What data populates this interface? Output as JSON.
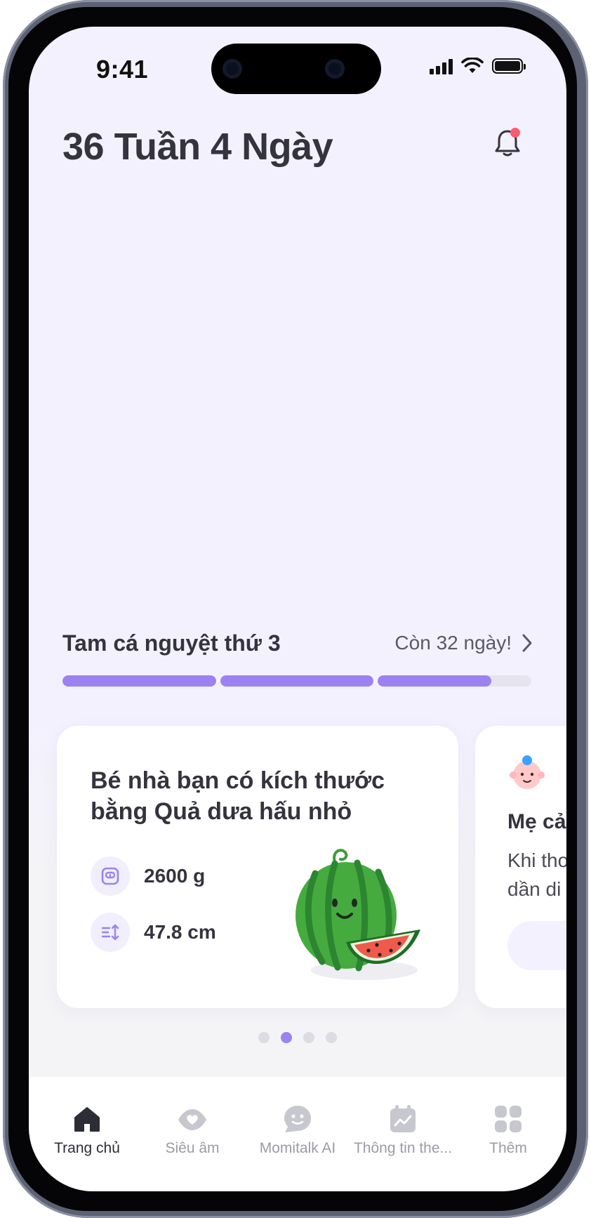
{
  "status_bar": {
    "time": "9:41"
  },
  "header": {
    "title": "36 Tuần 4 Ngày",
    "notification_icon": "bell-icon",
    "has_notification": true
  },
  "trimester": {
    "label": "Tam cá nguyệt thứ 3",
    "remaining": "Còn 32 ngày!",
    "segments": [
      1,
      1,
      0.74
    ]
  },
  "baby_card": {
    "heading": "Bé nhà bạn có kích thước bằng Quả dưa hấu nhỏ",
    "weight": "2600 g",
    "length": "47.8 cm",
    "fruit_icon": "watermelon-illustration"
  },
  "next_card": {
    "title": "Mẹ cả",
    "text_line1": "Khi thơ",
    "text_line2": "dần di"
  },
  "pager": {
    "count": 4,
    "active_index": 1
  },
  "bottom_nav": {
    "items": [
      {
        "label": "Trang chủ",
        "icon": "home-icon",
        "active": true
      },
      {
        "label": "Siêu âm",
        "icon": "ultrasound-icon",
        "active": false
      },
      {
        "label": "Momitalk AI",
        "icon": "chat-icon",
        "active": false
      },
      {
        "label": "Thông tin the...",
        "icon": "calendar-chart-icon",
        "active": false
      },
      {
        "label": "Thêm",
        "icon": "grid-icon",
        "active": false
      }
    ]
  },
  "colors": {
    "accent": "#9b82f0",
    "background": "#f3f1fe",
    "text": "#34343f",
    "notification_dot": "#ff5a6e"
  }
}
